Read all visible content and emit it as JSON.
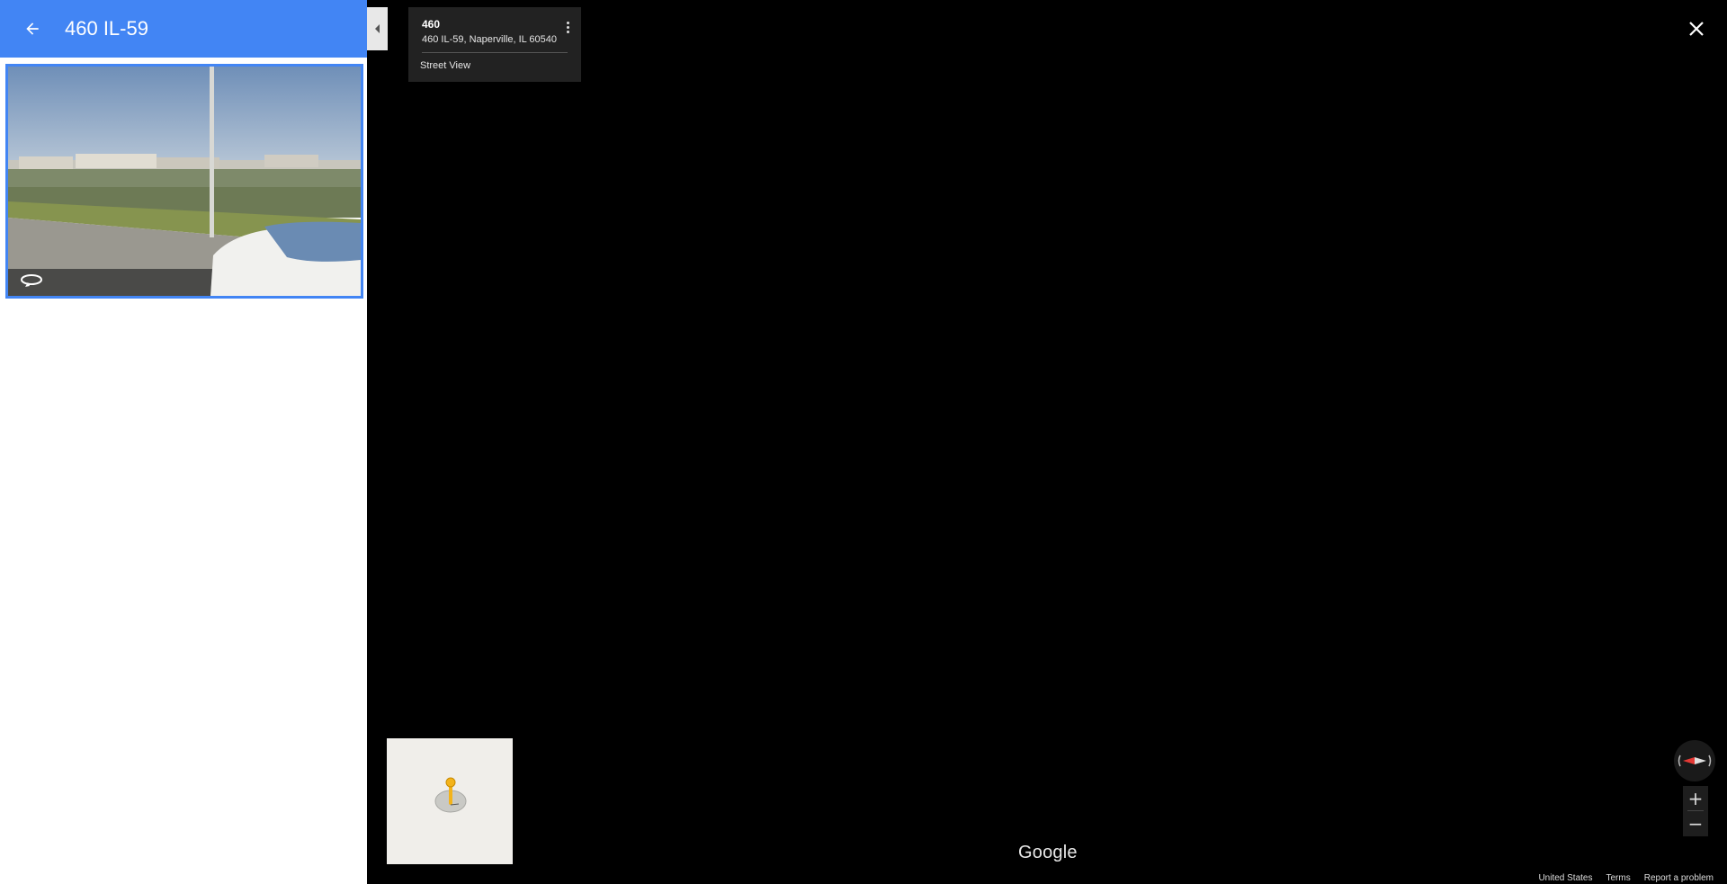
{
  "panel": {
    "title": "460 IL-59",
    "header_color": "#4285f4"
  },
  "info_card": {
    "title": "460",
    "address": "460 IL-59, Naperville, IL 60540",
    "link": "Street View"
  },
  "icons": {
    "back": "arrow-back-icon",
    "rotate": "360-rotate-icon",
    "collapse": "collapse-left-icon",
    "menu": "more-vert-icon",
    "close": "close-icon",
    "pegman": "pegman-icon",
    "compass": "compass-icon"
  },
  "controls": {
    "zoom_in": "+",
    "zoom_out": "−"
  },
  "branding": {
    "logo": "Google"
  },
  "footer": {
    "region": "United States",
    "terms": "Terms",
    "report": "Report a problem"
  }
}
